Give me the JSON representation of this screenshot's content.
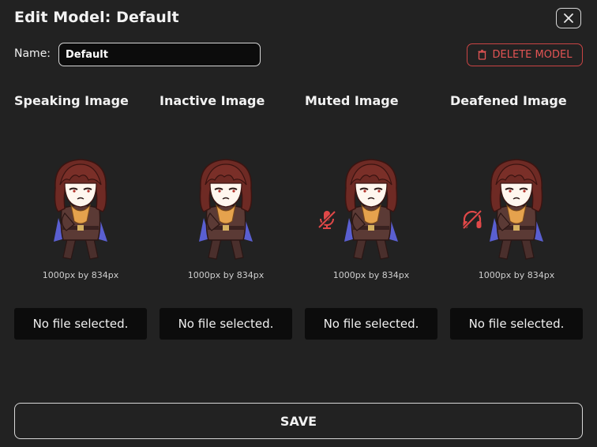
{
  "dialog": {
    "title": "Edit Model: Default",
    "close_icon": "close-icon"
  },
  "name_field": {
    "label": "Name:",
    "value": "Default"
  },
  "delete_button": {
    "label": "DELETE MODEL",
    "icon": "trash-icon",
    "color": "#e35454"
  },
  "columns": [
    {
      "title": "Speaking Image",
      "dims": "1000px by 834px",
      "file": "No file selected.",
      "status_icon": ""
    },
    {
      "title": "Inactive Image",
      "dims": "1000px by 834px",
      "file": "No file selected.",
      "status_icon": ""
    },
    {
      "title": "Muted Image",
      "dims": "1000px by 834px",
      "file": "No file selected.",
      "status_icon": "microphone-off-icon"
    },
    {
      "title": "Deafened Image",
      "dims": "1000px by 834px",
      "file": "No file selected.",
      "status_icon": "headphones-off-icon"
    }
  ],
  "save_button": {
    "label": "SAVE"
  },
  "colors": {
    "background": "#222222",
    "danger": "#e35454",
    "input_bg": "#0c0c0c"
  }
}
